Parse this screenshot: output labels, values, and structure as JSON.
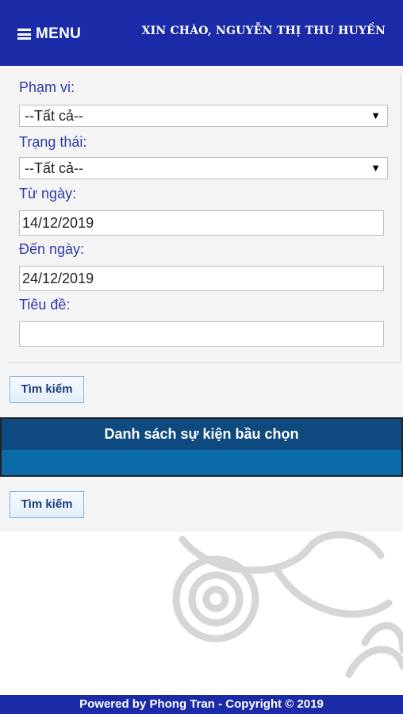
{
  "header": {
    "menu_label": "MENU",
    "greeting": "XIN CHÀO, NGUYỄN THỊ THU HUYỀN"
  },
  "filters": {
    "scope_label": "Phạm vi:",
    "scope_value": "--Tất cả--",
    "status_label": "Trạng thái:",
    "status_value": "--Tất cả--",
    "from_label": "Từ ngày:",
    "from_value": "14/12/2019",
    "to_label": "Đến ngày:",
    "to_value": "24/12/2019",
    "title_label": "Tiêu đề:",
    "title_value": ""
  },
  "search_button_label": "Tìm kiếm",
  "list": {
    "title": "Danh sách sự kiện bầu chọn"
  },
  "footer": {
    "text": "Powered by Phong Tran - Copyright © 2019"
  },
  "colors": {
    "brand": "#1b2aa6",
    "list_header": "#0e4a80",
    "list_body": "#0d6aa8",
    "label": "#2d3ba8"
  }
}
